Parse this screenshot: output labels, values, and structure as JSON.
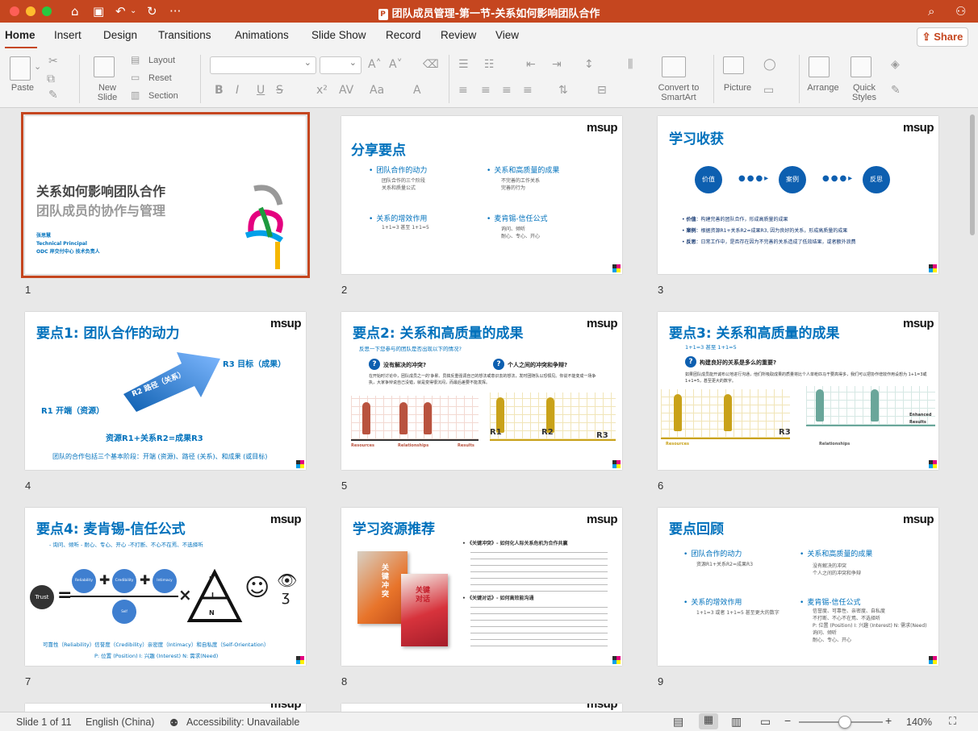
{
  "window": {
    "title": "团队成员管理-第一节-关系如何影响团队合作",
    "file_icon": "P"
  },
  "tabs": [
    "Home",
    "Insert",
    "Design",
    "Transitions",
    "Animations",
    "Slide Show",
    "Record",
    "Review",
    "View"
  ],
  "share_label": "Share",
  "ribbon": {
    "paste": "Paste",
    "new_slide": "New Slide",
    "layout": "Layout",
    "reset": "Reset",
    "section": "Section",
    "convert": "Convert to SmartArt",
    "picture": "Picture",
    "arrange": "Arrange",
    "quick_styles": "Quick Styles",
    "bold": "B",
    "italic": "I",
    "underline": "U",
    "strike": "S",
    "font_color": "A",
    "aa": "Aa"
  },
  "status": {
    "slide": "Slide 1 of 11",
    "language": "English (China)",
    "accessibility": "Accessibility: Unavailable",
    "zoom": "140%",
    "zoom_level": 0.55
  },
  "brand": "msup",
  "slides": [
    {
      "num": "1",
      "title1": "关系如何影响团队合作",
      "title2": "团队成员的协作与管理",
      "name": "张思慧",
      "role": "Technical Principal",
      "org": "ODC 岸交付中心 技术负责人"
    },
    {
      "num": "2",
      "title": "分享要点",
      "b1": "团队合作的动力",
      "b1s": [
        "团队合作的三个阶段",
        "关系和质量公式"
      ],
      "b2": "关系和高质量的成果",
      "b2s": [
        "不完善的工作关系",
        "完善的行为"
      ],
      "b3": "关系的增效作用",
      "b3s": [
        "1+1=3 甚至 1+1=5"
      ],
      "b4": "麦肯锡-信任公式",
      "b4s": [
        "询问、倾听",
        "耐心、专心、开心"
      ]
    },
    {
      "num": "3",
      "title": "学习收获",
      "c1": "价值",
      "c2": "案例",
      "c3": "反思",
      "l1k": "价值",
      "l1": "：构建完善的团队合作，形成高质量的成果",
      "l2k": "案例",
      "l2": "：根据资源R1+关系R2=成果R3, 因为良好的关系，形成高质量的成果",
      "l3k": "反思",
      "l3": "：日常工作中，是否存在因为不完善的关系造成了低效结果，或者额外浪费"
    },
    {
      "num": "4",
      "title": "要点1: 团队合作的动力",
      "r1": "R1 开端（资源）",
      "r2": "R2 路径（关系）",
      "r3": "R3 目标（成果）",
      "formula": "资源R1+关系R2=成果R3",
      "note": "团队的合作包括三个基本阶段：开端 (资源)、路径 (关系)、和成果 (或目标)"
    },
    {
      "num": "5",
      "title": "要点2: 关系和高质量的成果",
      "sub": "反思一下您参与的团队是否出现以下的情况?",
      "q1": "没有解决的冲突?",
      "q2": "个人之间的冲突和争辩?",
      "body": "在开始时讨论中，团队成员之一的'争累、员搞反重强调自己的想法或意识去的想法，发时团随队以恐惧见。你说不能变成一场争执，大家争辩说自己没错，就是变得很沉闷，而最后差要不能发挥。",
      "lr": "Resources",
      "lrel": "Relationships",
      "lres": "Results"
    },
    {
      "num": "6",
      "title": "要点3: 关系和高质量的成果",
      "sub": "1+1=3 甚至 1+1=5",
      "q1": "构建良好的关系是多么的重要?",
      "body": "如果团队成员能开诚布公地进行沟通，他们所吸取成果的质量将比个人单枪匹马干要高得多，我们可以把协作增效作用设想为 1+1=3或1+1=5，甚至更大的数字。",
      "lr": "Resources",
      "lrel": "Relationships",
      "lres": "Enhanced Results"
    },
    {
      "num": "7",
      "title": "要点4: 麦肯锡-信任公式",
      "sub": "- 询问、倾听    - 耐心、专心、开心    -不打断、不心不在焉、不选择听",
      "trust": "Trust",
      "rel": "Reliability",
      "cred": "Credibility",
      "intim": "Intimacy",
      "self": "Self Orientation",
      "p": "P",
      "i": "I",
      "n": "N",
      "f1": "可靠性（Reliability）信誉度（Credibility）亲密度（Intimacy）和自私度（Self-Orientation）",
      "f2": "P: 位置 (Position) I: 兴趣 (Interest) N: 需求(Need)"
    },
    {
      "num": "8",
      "title": "学习资源推荐",
      "book1": "关键冲突",
      "book2": "关键对话",
      "a1": "《关键冲突》- 如何化人际关系危机为合作共赢",
      "a2": "《关键对话》- 如何高效能沟通"
    },
    {
      "num": "9",
      "title": "要点回顾",
      "b1": "团队合作的动力",
      "b1s": [
        "资源R1+关系R2=成果R3"
      ],
      "b2": "关系和高质量的成果",
      "b2s": [
        "没有解决的冲突",
        "个人之间的冲突和争辩"
      ],
      "b3": "关系的增效作用",
      "b3s": [
        "1+1=3 或者 1+1=5 甚至更大的数字"
      ],
      "b4": "麦肯锡-信任公式",
      "b4s": [
        "信誉度、可靠性、亲密度、自私度",
        "不打断、不心不在焉、不选择听",
        "P: 位置 (Position) I: 兴趣 (Interest) N: 需求(Need)",
        "询问、倾听",
        "耐心、专心、开心"
      ]
    }
  ]
}
